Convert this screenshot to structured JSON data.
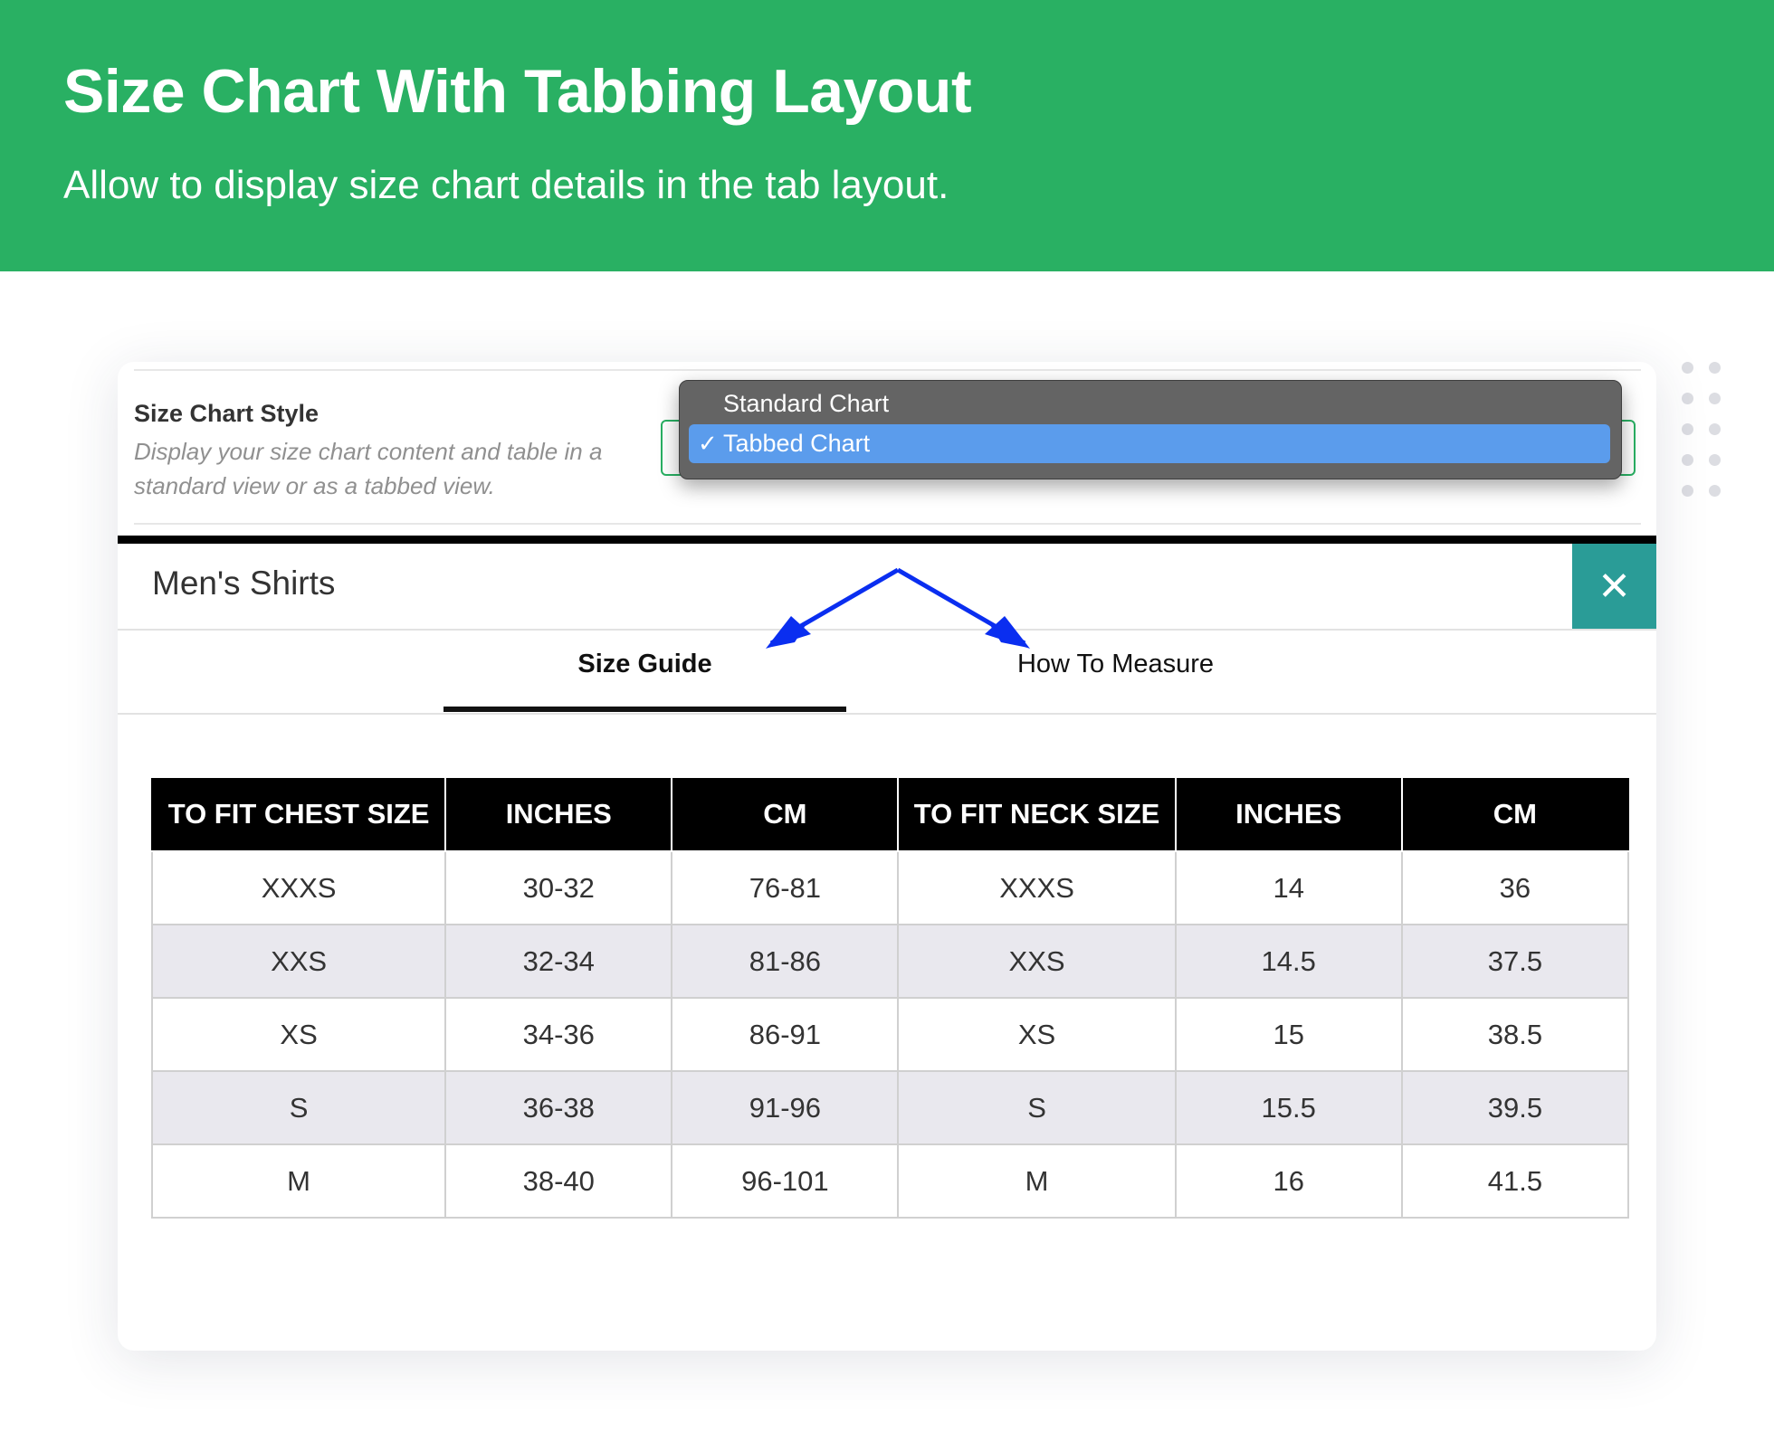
{
  "banner": {
    "title": "Size Chart With Tabbing Layout",
    "subtitle": "Allow to display size chart details in the tab layout."
  },
  "setting": {
    "label": "Size Chart Style",
    "description": "Display your size chart content and table in a standard view or as a tabbed view.",
    "options": [
      "Standard Chart",
      "Tabbed Chart"
    ],
    "selected": "Tabbed Chart",
    "check_glyph": "✓"
  },
  "modal": {
    "title": "Men's Shirts",
    "close_glyph": "✕",
    "tabs": [
      {
        "label": "Size Guide",
        "active": true
      },
      {
        "label": "How To Measure",
        "active": false
      }
    ]
  },
  "table": {
    "headers": [
      "TO FIT CHEST SIZE",
      "INCHES",
      "CM",
      "TO FIT NECK SIZE",
      "INCHES",
      "CM"
    ],
    "rows": [
      [
        "XXXS",
        "30-32",
        "76-81",
        "XXXS",
        "14",
        "36"
      ],
      [
        "XXS",
        "32-34",
        "81-86",
        "XXS",
        "14.5",
        "37.5"
      ],
      [
        "XS",
        "34-36",
        "86-91",
        "XS",
        "15",
        "38.5"
      ],
      [
        "S",
        "36-38",
        "91-96",
        "S",
        "15.5",
        "39.5"
      ],
      [
        "M",
        "38-40",
        "96-101",
        "M",
        "16",
        "41.5"
      ]
    ]
  },
  "colors": {
    "banner": "#29b063",
    "close_button": "#2a9c97",
    "dropdown_bg": "#646464",
    "dropdown_selected": "#5b9cec",
    "arrow": "#0a2ef0"
  }
}
